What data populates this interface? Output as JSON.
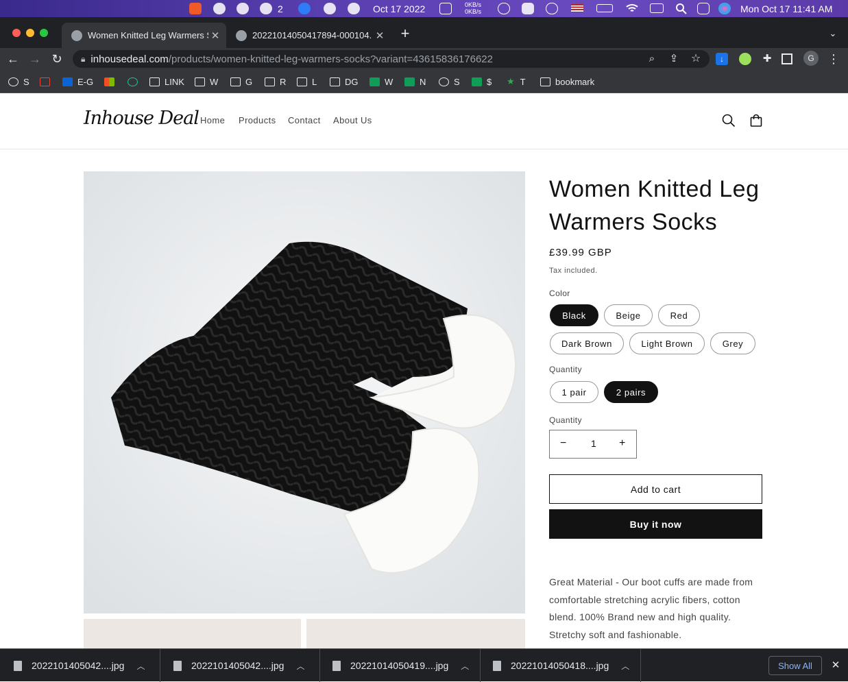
{
  "menubar": {
    "wechat_count": "2",
    "date_center": "Oct 17 2022",
    "net_up": "0KB/s",
    "net_down": "0KB/s",
    "clock": "Mon Oct 17  11:41 AM"
  },
  "browser": {
    "tabs": [
      {
        "title": "Women Knitted Leg Warmers S",
        "active": true
      },
      {
        "title": "20221014050417894-000104.",
        "active": false
      }
    ],
    "new_tab": "+",
    "url_domain": "inhousedeal.com",
    "url_path": "/products/women-knitted-leg-warmers-socks?variant=43615836176622",
    "bookmarks": [
      "S",
      "",
      "E-G",
      "",
      "",
      "LINK",
      "W",
      "G",
      "R",
      "L",
      "DG",
      "W",
      "N",
      "S",
      "$",
      "T",
      "bookmark"
    ],
    "profile_initial": "G"
  },
  "site": {
    "logo": "Inhouse Deal",
    "nav": [
      "Home",
      "Products",
      "Contact",
      "About Us"
    ]
  },
  "product": {
    "title": "Women Knitted Leg Warmers Socks",
    "price": "£39.99 GBP",
    "tax_note": "Tax included.",
    "color_label": "Color",
    "colors": [
      "Black",
      "Beige",
      "Red",
      "Dark Brown",
      "Light Brown",
      "Grey"
    ],
    "selected_color": "Black",
    "pack_label": "Quantity",
    "packs": [
      "1 pair",
      "2 pairs"
    ],
    "selected_pack": "2 pairs",
    "quantity_label": "Quantity",
    "quantity_value": "1",
    "minus": "−",
    "plus": "+",
    "add_to_cart": "Add to cart",
    "buy_now": "Buy it now",
    "description": "Great Material - Our boot cuffs are made from comfortable stretching acrylic fibers, cotton blend. 100% Brand new and high quality. Stretchy soft and fashionable."
  },
  "downloads": {
    "items": [
      "2022101405042....jpg",
      "2022101405042....jpg",
      "20221014050419....jpg",
      "20221014050418....jpg"
    ],
    "show_all": "Show All",
    "close": "✕"
  },
  "colors": {
    "accent_dark": "#121212",
    "chrome_dark": "#202124",
    "chrome_mid": "#35363a",
    "link_blue": "#8ab4f8"
  }
}
